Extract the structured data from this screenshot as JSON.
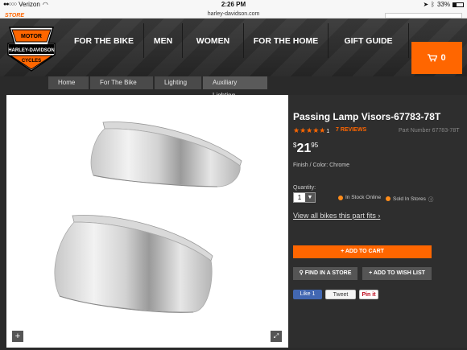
{
  "status": {
    "carrier": "Verizon",
    "time": "2:26 PM",
    "battery": "33%"
  },
  "browser": {
    "url": "harley-davidson.com"
  },
  "site": {
    "store_label": "STORE"
  },
  "nav": {
    "logo_top": "MOTOR",
    "logo_mid": "HARLEY-DAVIDSON",
    "logo_bottom": "CYCLES",
    "items": [
      "FOR THE BIKE",
      "MEN",
      "WOMEN",
      "FOR THE HOME",
      "GIFT GUIDE"
    ],
    "cart_count": "0"
  },
  "breadcrumb": [
    "Home",
    "For The Bike",
    "Lighting",
    "Auxiliary Lighting"
  ],
  "product": {
    "title": "Passing Lamp Visors-67783-78T",
    "rating": 4.5,
    "stars": "★★★★★",
    "rating_count": "1",
    "reviews_label": "7 REVIEWS",
    "part_number": "Part Number 67783-78T",
    "price_currency": "$",
    "price_dollars": "21",
    "price_cents": "95",
    "finish": "Finish / Color:  Chrome",
    "quantity_label": "Quantity:",
    "quantity_value": "1",
    "in_stock": "In Stock Online",
    "sold_in_stores": "Sold In Stores",
    "view_bikes": "View all bikes this part fits",
    "add_to_cart": "ADD TO CART",
    "find_store": "FIND IN A STORE",
    "add_wishlist": "ADD TO WISH LIST"
  },
  "social": {
    "facebook": "Like 1",
    "twitter": "Tweet",
    "pinterest": "Pin it"
  },
  "colors": {
    "accent": "#ff6600",
    "facebook": "#4267b2"
  }
}
